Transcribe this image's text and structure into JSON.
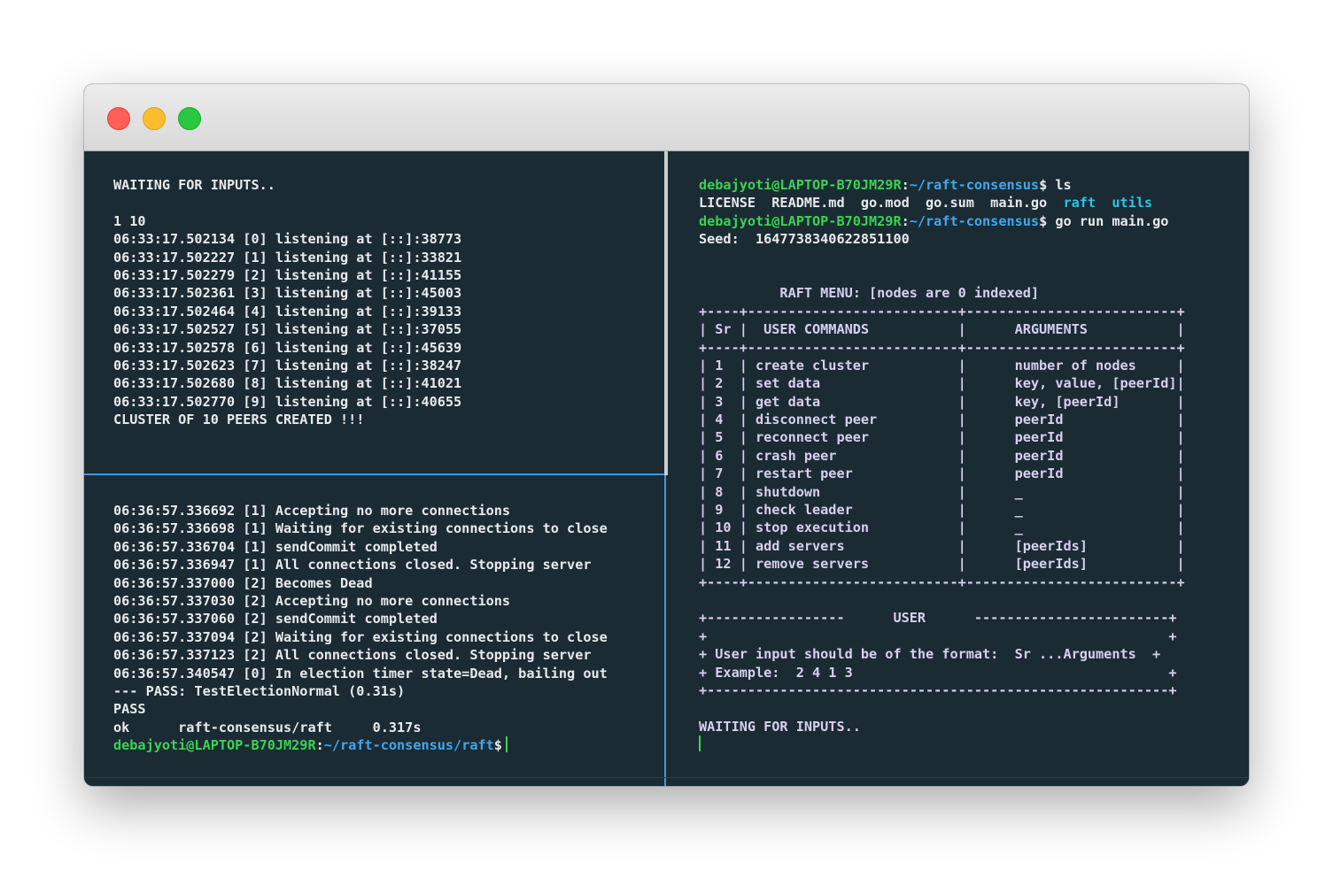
{
  "window": {
    "traffic_lights": {
      "close": {
        "color": "#ff5f57"
      },
      "minimize": {
        "color": "#febc2e"
      },
      "maximize": {
        "color": "#28c840"
      }
    }
  },
  "top_left_pane": {
    "lines": [
      "WAITING FOR INPUTS..",
      "",
      "1 10",
      "06:33:17.502134 [0] listening at [::]:38773",
      "06:33:17.502227 [1] listening at [::]:33821",
      "06:33:17.502279 [2] listening at [::]:41155",
      "06:33:17.502361 [3] listening at [::]:45003",
      "06:33:17.502464 [4] listening at [::]:39133",
      "06:33:17.502527 [5] listening at [::]:37055",
      "06:33:17.502578 [6] listening at [::]:45639",
      "06:33:17.502623 [7] listening at [::]:38247",
      "06:33:17.502680 [8] listening at [::]:41021",
      "06:33:17.502770 [9] listening at [::]:40655",
      "CLUSTER OF 10 PEERS CREATED !!!"
    ]
  },
  "bottom_left_pane": {
    "lines": [
      "06:36:57.336692 [1] Accepting no more connections",
      "06:36:57.336698 [1] Waiting for existing connections to close",
      "06:36:57.336704 [1] sendCommit completed",
      "06:36:57.336947 [1] All connections closed. Stopping server",
      "06:36:57.337000 [2] Becomes Dead",
      "06:36:57.337030 [2] Accepting no more connections",
      "06:36:57.337060 [2] sendCommit completed",
      "06:36:57.337094 [2] Waiting for existing connections to close",
      "06:36:57.337123 [2] All connections closed. Stopping server",
      "06:36:57.340547 [0] In election timer state=Dead, bailing out",
      "--- PASS: TestElectionNormal (0.31s)",
      "PASS",
      "ok      raft-consensus/raft     0.317s"
    ],
    "prompt": {
      "user": "debajyoti@LAPTOP-B70JM29R",
      "sep": ":",
      "path": "~/raft-consensus/raft",
      "symbol": "$"
    }
  },
  "right_pane": {
    "prompt1": {
      "user": "debajyoti@LAPTOP-B70JM29R",
      "sep": ":",
      "path": "~/raft-consensus",
      "symbol": "$",
      "command": " ls"
    },
    "ls_files": "LICENSE  README.md  go.mod  go.sum  main.go  ",
    "ls_dirs": "raft  utils",
    "prompt2": {
      "user": "debajyoti@LAPTOP-B70JM29R",
      "sep": ":",
      "path": "~/raft-consensus",
      "symbol": "$",
      "command": " go run main.go"
    },
    "seed_line": "Seed:  1647738340622851100",
    "menu_lines": [
      "",
      "",
      "          RAFT MENU: [nodes are 0 indexed]",
      "+----+--------------------------+--------------------------+",
      "| Sr |  USER COMMANDS           |      ARGUMENTS           |",
      "+----+--------------------------+--------------------------+",
      "| 1  | create cluster           |      number of nodes     |",
      "| 2  | set data                 |      key, value, [peerId]|",
      "| 3  | get data                 |      key, [peerId]       |",
      "| 4  | disconnect peer          |      peerId              |",
      "| 5  | reconnect peer           |      peerId              |",
      "| 6  | crash peer               |      peerId              |",
      "| 7  | restart peer             |      peerId              |",
      "| 8  | shutdown                 |      _                   |",
      "| 9  | check leader             |      _                   |",
      "| 10 | stop execution           |      _                   |",
      "| 11 | add servers              |      [peerIds]           |",
      "| 12 | remove servers           |      [peerIds]           |",
      "+----+--------------------------+--------------------------+",
      "",
      "+-----------------      USER      ------------------------+",
      "+                                                         +",
      "+ User input should be of the format:  Sr ...Arguments  +",
      "+ Example:  2 4 1 3                                       +",
      "+---------------------------------------------------------+",
      "",
      "WAITING FOR INPUTS.."
    ]
  }
}
